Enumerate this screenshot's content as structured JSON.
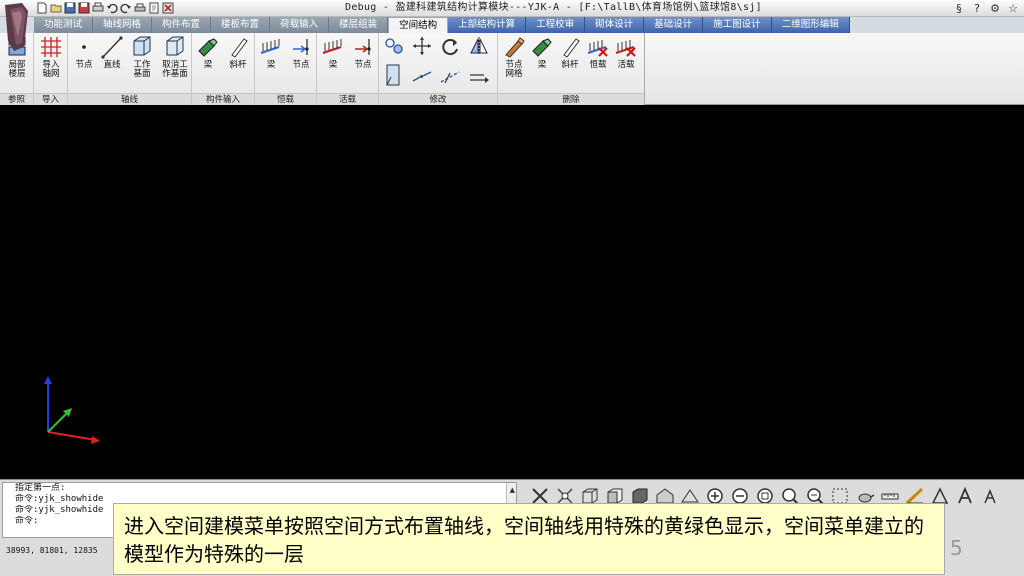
{
  "window": {
    "title": "Debug - 盈建科建筑结构计算模块---YJK-A - [F:\\TallB\\体育场馆例\\篮球馆8\\sj]"
  },
  "tabs": [
    {
      "label": "功能测试",
      "style": "gray"
    },
    {
      "label": "轴线网格",
      "style": "gray"
    },
    {
      "label": "构件布置",
      "style": "gray"
    },
    {
      "label": "楼板布置",
      "style": "gray"
    },
    {
      "label": "荷载输入",
      "style": "gray"
    },
    {
      "label": "楼层组装",
      "style": "gray"
    },
    {
      "label": "空间结构",
      "style": "active"
    },
    {
      "label": "上部结构计算",
      "style": "blue"
    },
    {
      "label": "工程校审",
      "style": "blue"
    },
    {
      "label": "砌体设计",
      "style": "blue"
    },
    {
      "label": "基础设计",
      "style": "blue"
    },
    {
      "label": "施工图设计",
      "style": "blue"
    },
    {
      "label": "二维图形编辑",
      "style": "blue"
    }
  ],
  "ribbon": {
    "groups": {
      "reference": "参照",
      "import": "导入",
      "axis": "轴线",
      "member": "构件输入",
      "dead": "恒载",
      "live": "活载",
      "modify": "修改",
      "delete": "删除"
    },
    "buttons": {
      "local_floor_1": "局部",
      "local_floor_2": "楼层",
      "import_1": "导入",
      "import_2": "轴网",
      "node": "节点",
      "line": "直线",
      "workplane_1": "工作",
      "workplane_2": "基面",
      "cancel_wp_1": "取消工",
      "cancel_wp_2": "作基面",
      "beam": "梁",
      "brace": "斜杆",
      "dead_beam": "梁",
      "dead_node": "节点",
      "live_beam": "梁",
      "live_node": "节点",
      "del_node_grid_1": "节点",
      "del_node_grid_2": "网格",
      "del_beam": "梁",
      "del_brace": "斜杆",
      "del_dead": "恒载",
      "del_live": "活载"
    }
  },
  "command": {
    "lines": [
      "指定第一点:",
      "命令:yjk_showhide",
      "命令:yjk_showhide",
      "命令:"
    ]
  },
  "status": {
    "coords": "38993, 81801, 12835"
  },
  "subtitle": {
    "text": "进入空间建模菜单按照空间方式布置轴线，空间轴线用特殊的黄绿色显示，空间菜单建立的模型作为特殊的一层"
  },
  "page_number": "5",
  "colors": {
    "canvas": "#000000",
    "subtitle_bg": "#ffffc8",
    "active_tab": "#f4f4f4",
    "blue_tab": "#3e63ad",
    "axis_x": "#e02020",
    "axis_y": "#2040e0",
    "axis_z": "#30c030"
  }
}
